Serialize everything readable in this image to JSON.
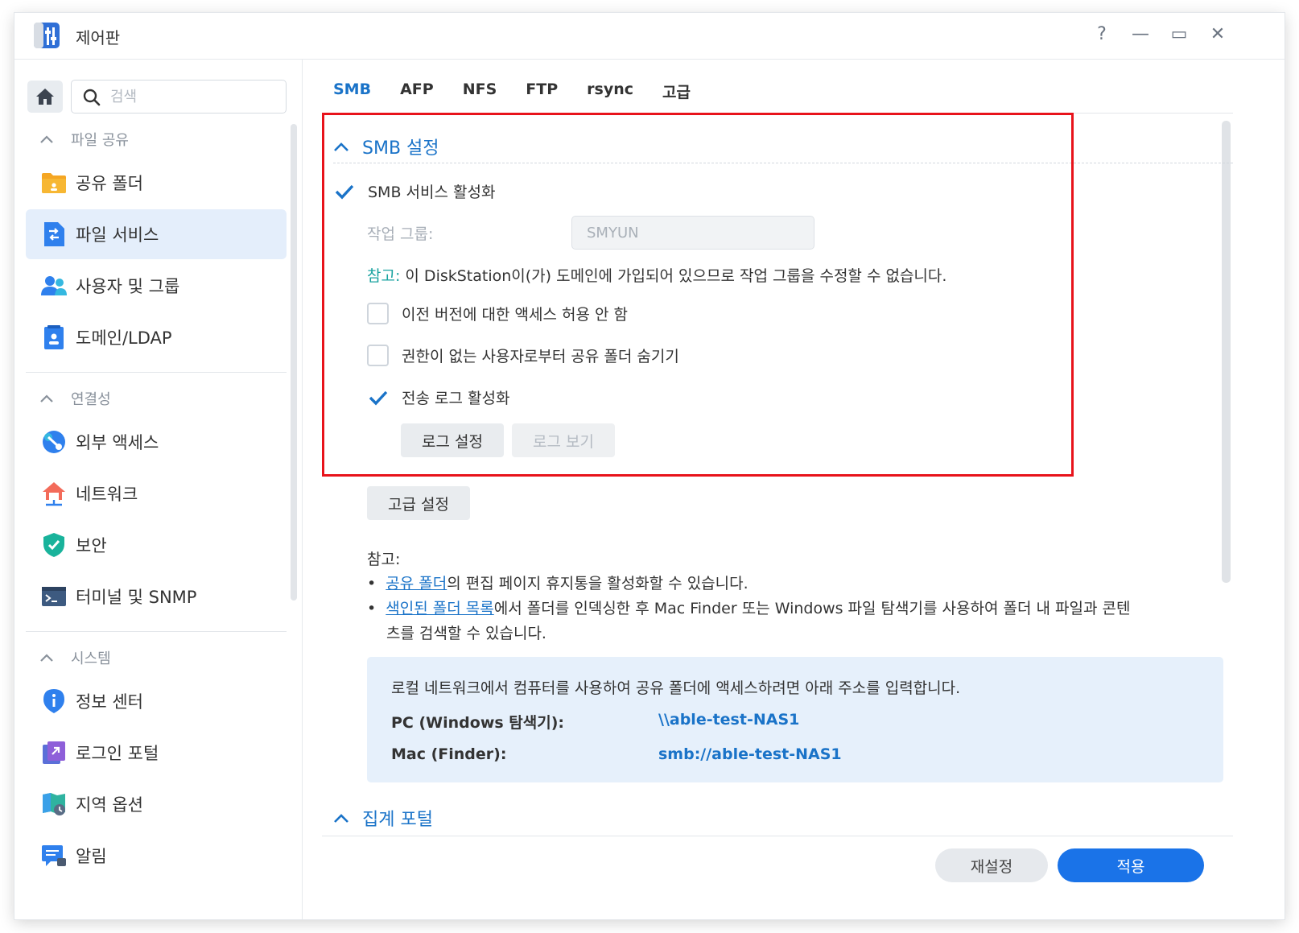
{
  "window": {
    "title": "제어판",
    "help": "?",
    "minimize": "—",
    "maximize": "▭",
    "close": "✕"
  },
  "search": {
    "placeholder": "검색"
  },
  "sidebar": {
    "sections": [
      {
        "label": "파일 공유",
        "items": [
          {
            "label": "공유 폴더",
            "icon": "shared-folder-icon"
          },
          {
            "label": "파일 서비스",
            "icon": "file-services-icon",
            "active": true
          },
          {
            "label": "사용자 및 그룹",
            "icon": "users-icon"
          },
          {
            "label": "도메인/LDAP",
            "icon": "domain-icon"
          }
        ]
      },
      {
        "label": "연결성",
        "items": [
          {
            "label": "외부 액세스",
            "icon": "external-access-icon"
          },
          {
            "label": "네트워크",
            "icon": "network-icon"
          },
          {
            "label": "보안",
            "icon": "security-shield-icon"
          },
          {
            "label": "터미널 및 SNMP",
            "icon": "terminal-icon"
          }
        ]
      },
      {
        "label": "시스템",
        "items": [
          {
            "label": "정보 센터",
            "icon": "info-icon"
          },
          {
            "label": "로그인 포털",
            "icon": "login-portal-icon"
          },
          {
            "label": "지역 옵션",
            "icon": "regional-options-icon"
          },
          {
            "label": "알림",
            "icon": "notification-icon"
          }
        ]
      }
    ]
  },
  "tabs": [
    "SMB",
    "AFP",
    "NFS",
    "FTP",
    "rsync",
    "고급"
  ],
  "smb": {
    "section_title": "SMB 설정",
    "enable_label": "SMB 서비스 활성화",
    "enable_checked": true,
    "workgroup_label": "작업 그룹:",
    "workgroup_value": "SMYUN",
    "note_prefix": "참고:",
    "note_text": " 이 DiskStation이(가) 도메인에 가입되어 있으므로 작업 그룹을 수정할 수 없습니다.",
    "opt_prev_versions": "이전 버전에 대한 액세스 허용 안 함",
    "opt_prev_versions_checked": false,
    "opt_hide_folders": "권한이 없는 사용자로부터 공유 폴더 숨기기",
    "opt_hide_folders_checked": false,
    "opt_transfer_log": "전송 로그 활성화",
    "opt_transfer_log_checked": true,
    "log_settings_btn": "로그 설정",
    "view_logs_btn": "로그 보기",
    "advanced_btn": "고급 설정"
  },
  "notes": {
    "label": "참고:",
    "b1_link": "공유 폴더",
    "b1_rest": "의 편집 페이지 휴지통을 활성화할 수 있습니다.",
    "b2_link": "색인된 폴더 목록",
    "b2_rest1": "에서 폴더를 인덱싱한 후 Mac Finder 또는 Windows 파일 탐색기를 사용하여 폴더 내 파일과 콘텐",
    "b2_rest2": "츠를 검색할 수 있습니다."
  },
  "access": {
    "intro": "로컬 네트워크에서 컴퓨터를 사용하여 공유 폴더에 액세스하려면 아래 주소를 입력합니다.",
    "pc_label": "PC (Windows 탐색기):",
    "pc_value": "\\\\able-test-NAS1",
    "mac_label": "Mac (Finder):",
    "mac_value": "smb://able-test-NAS1"
  },
  "aggregation": {
    "title": "집계 포털"
  },
  "footer": {
    "reset": "재설정",
    "apply": "적용"
  },
  "colors": {
    "accent": "#1a73c8",
    "highlight": "#e8131b",
    "note": "#19a3a0"
  }
}
